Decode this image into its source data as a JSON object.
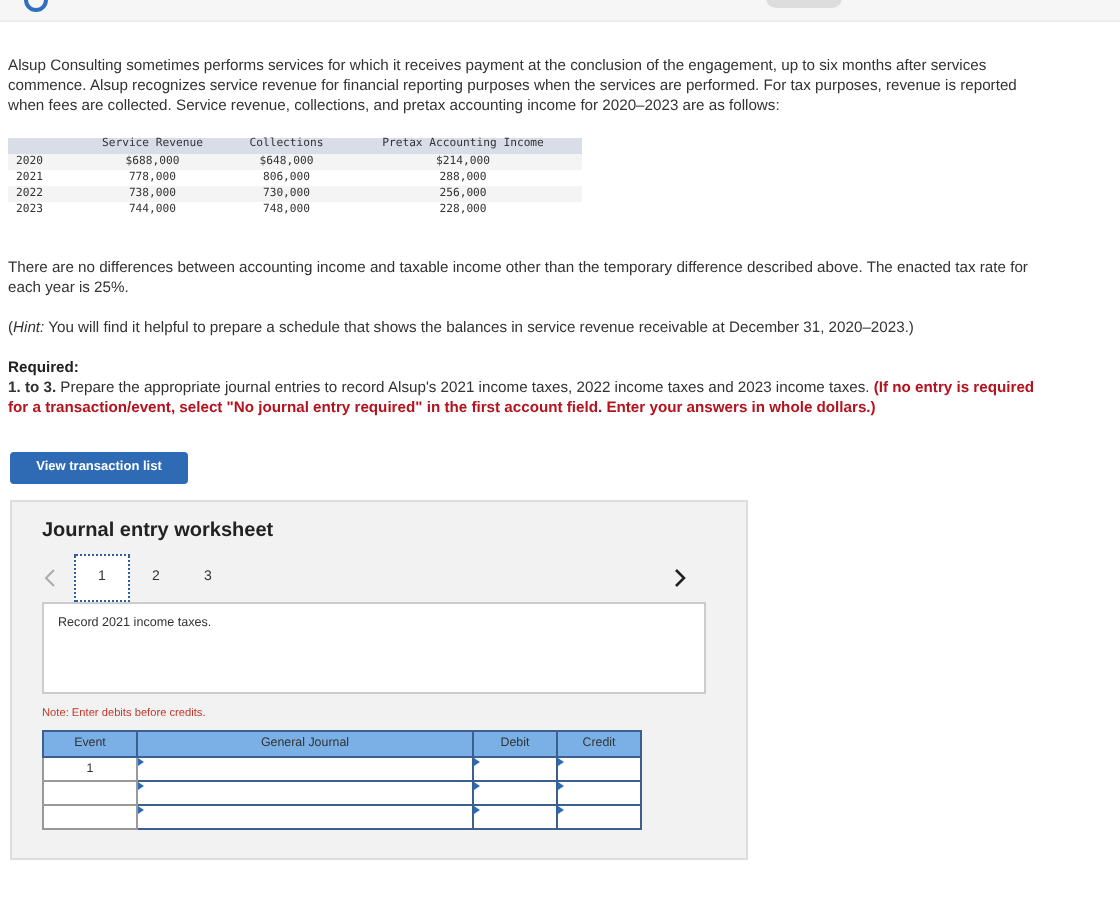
{
  "intro": "Alsup Consulting sometimes performs services for which it receives payment at the conclusion of the engagement, up to six months after services commence. Alsup recognizes service revenue for financial reporting purposes when the services are performed. For tax purposes, revenue is reported when fees are collected. Service revenue, collections, and pretax accounting income for 2020–2023 are as follows:",
  "data_table": {
    "columns": [
      "Service Revenue",
      "Collections",
      "Pretax Accounting Income"
    ],
    "rows": [
      {
        "year": "2020",
        "cells": [
          "$688,000",
          "$648,000",
          "$214,000"
        ]
      },
      {
        "year": "2021",
        "cells": [
          "778,000",
          "806,000",
          "288,000"
        ]
      },
      {
        "year": "2022",
        "cells": [
          "738,000",
          "730,000",
          "256,000"
        ]
      },
      {
        "year": "2023",
        "cells": [
          "744,000",
          "748,000",
          "228,000"
        ]
      }
    ]
  },
  "note_text": "There are no differences between accounting income and taxable income other than the temporary difference described above. The enacted tax rate for each year is 25%.",
  "hint": "(*Hint:* You will find it helpful to prepare a schedule that shows the balances in service revenue receivable at December 31, 2020–2023.)",
  "required_label": "Required:",
  "instructions": "**1. to 3.** Prepare the appropriate journal entries to record Alsup's 2021 income taxes, 2022 income taxes and 2023 income taxes.",
  "instructions_warning": "(If no entry is required for a transaction/event, select \"No journal entry required\" in the first account field. Enter your answers in whole dollars.)",
  "view_button": "View transaction list",
  "worksheet": {
    "title": "Journal entry worksheet",
    "tabs": [
      {
        "label": "1",
        "selected": true
      },
      {
        "label": "2",
        "selected": false
      },
      {
        "label": "3",
        "selected": false
      }
    ],
    "prompt": "Record 2021 income taxes.",
    "note": "Note: Enter debits before credits.",
    "columns": [
      "Event",
      "General Journal",
      "Debit",
      "Credit"
    ],
    "rows": [
      {
        "event": "1"
      },
      {},
      {}
    ]
  }
}
